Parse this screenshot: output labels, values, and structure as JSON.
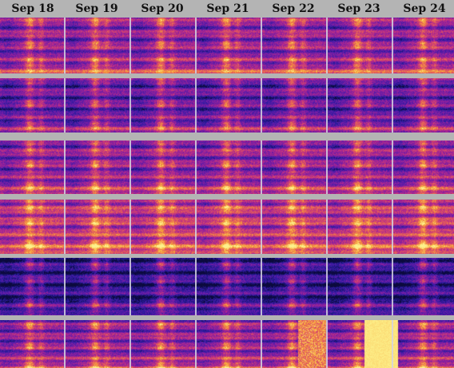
{
  "days": [
    "Sep 18",
    "Sep 19",
    "Sep 20",
    "Sep 21",
    "Sep 22",
    "Sep 23",
    "Sep 24"
  ],
  "colors": {
    "background": "#b4b4b4",
    "colormap": [
      "#0b0a3d",
      "#2a1ba0",
      "#6a1ca8",
      "#b0278f",
      "#e2555e",
      "#f7a33a",
      "#fdf18b"
    ]
  },
  "strips": [
    {
      "id": "strip-1",
      "intensity": "medium",
      "note": ""
    },
    {
      "id": "strip-2",
      "intensity": "low",
      "note": ""
    },
    {
      "id": "strip-3",
      "intensity": "medium",
      "note": ""
    },
    {
      "id": "strip-4",
      "intensity": "high",
      "note": ""
    },
    {
      "id": "strip-5",
      "intensity": "very-low",
      "note": ""
    },
    {
      "id": "strip-6",
      "intensity": "medium",
      "note": ""
    }
  ]
}
